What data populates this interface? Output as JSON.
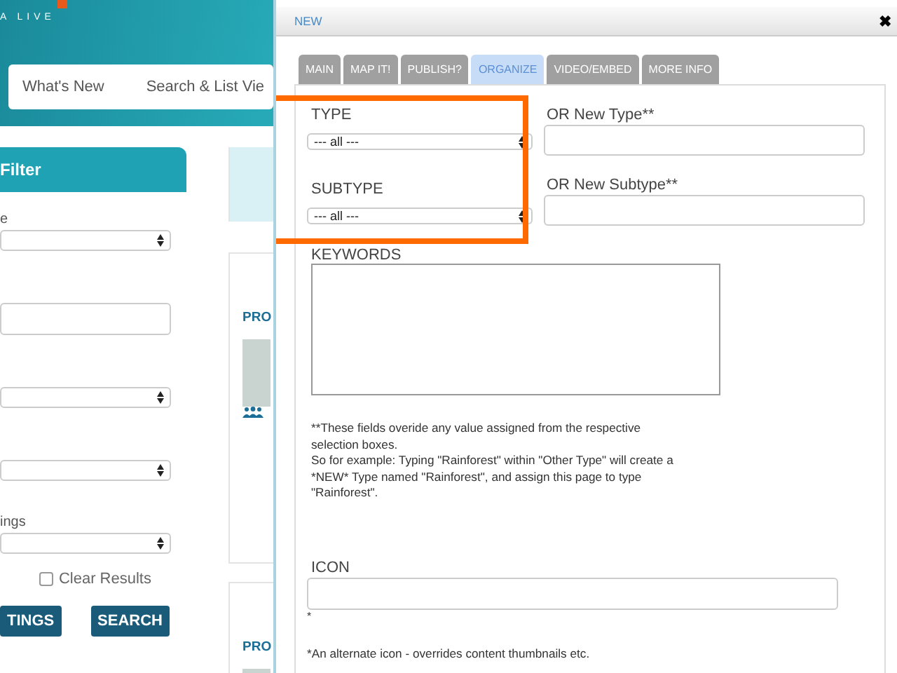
{
  "site": {
    "logo_text": "A LIVE",
    "nav": [
      {
        "label": "What's New"
      },
      {
        "label": "Search & List Vie"
      }
    ]
  },
  "filter": {
    "title": "Filter",
    "fields": [
      {
        "kind": "select",
        "label": "e"
      },
      {
        "kind": "input"
      },
      {
        "kind": "select"
      },
      {
        "kind": "select"
      },
      {
        "kind": "select",
        "label": "ings"
      }
    ],
    "clear_results": {
      "label": "Clear Results",
      "checked": false
    },
    "buttons": [
      "TINGS",
      "SEARCH"
    ]
  },
  "results": [
    {
      "title": "PRO"
    },
    {
      "title": "PRO"
    }
  ],
  "dialog": {
    "title": "NEW",
    "close": "✖",
    "tabs": [
      {
        "label": "MAIN",
        "selected": false
      },
      {
        "label": "MAP IT!",
        "selected": false
      },
      {
        "label": "PUBLISH?",
        "selected": false
      },
      {
        "label": "ORGANIZE",
        "selected": true
      },
      {
        "label": "VIDEO/EMBED",
        "selected": false
      },
      {
        "label": "MORE INFO",
        "selected": false
      }
    ],
    "type": {
      "label": "TYPE",
      "value": "--- all ---"
    },
    "subtype": {
      "label": "SUBTYPE",
      "value": "--- all ---"
    },
    "new_type": {
      "label": "OR New Type**"
    },
    "new_subtype": {
      "label": "OR New Subtype**"
    },
    "keywords": {
      "label": "KEYWORDS"
    },
    "note": [
      "**These fields overide any value assigned from the respective selection boxes.",
      "So for example: Typing \"Rainforest\" within \"Other Type\" will create a *NEW* Type named \"Rainforest\", and assign this page to type \"Rainforest\"."
    ],
    "icon": {
      "label": "ICON",
      "marker": "*",
      "hint": "*An alternate icon - overrides content thumbnails etc."
    }
  }
}
